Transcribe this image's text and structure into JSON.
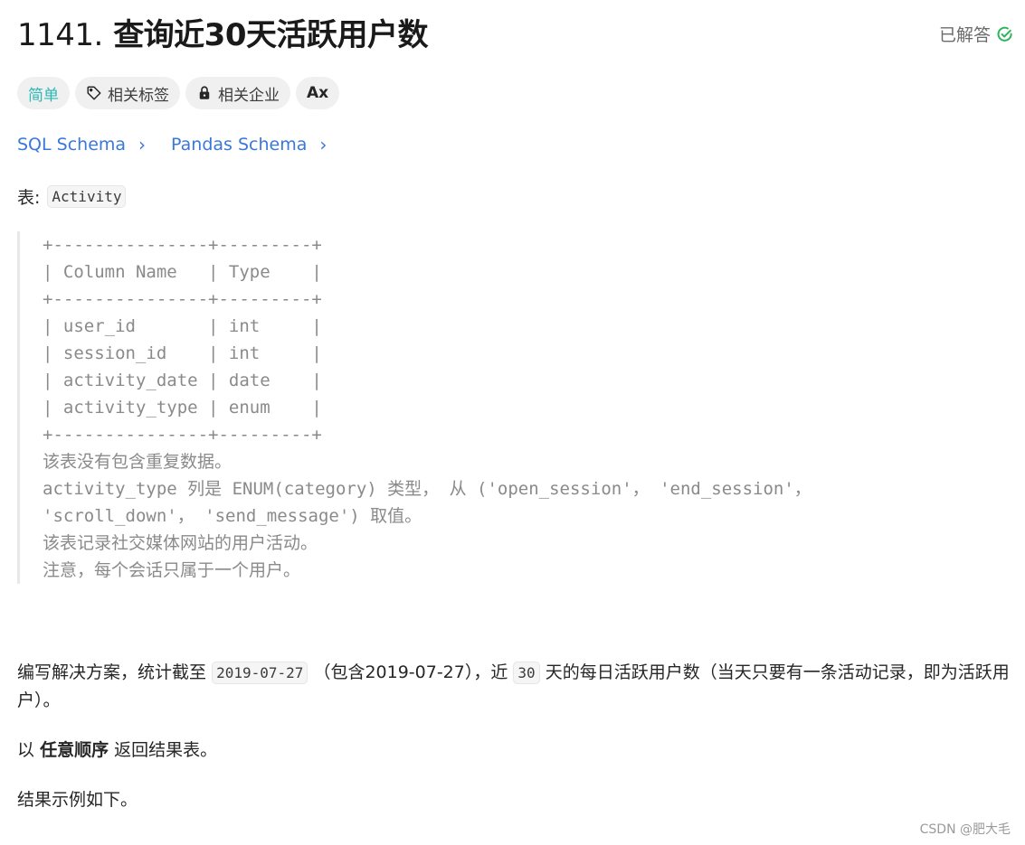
{
  "header": {
    "number": "1141.",
    "title": "查询近30天活跃用户数",
    "status_label": "已解答",
    "status_color": "#2db55d"
  },
  "tags": [
    {
      "label": "简单",
      "icon": null,
      "color": "#2db7b5"
    },
    {
      "label": "相关标签",
      "icon": "tag-icon"
    },
    {
      "label": "相关企业",
      "icon": "lock-icon"
    },
    {
      "label": "Ax",
      "icon": "translate-icon"
    }
  ],
  "schema_links": [
    {
      "label": "SQL Schema"
    },
    {
      "label": "Pandas Schema"
    }
  ],
  "table": {
    "label": "表:",
    "name": "Activity",
    "schema_text": "+---------------+---------+\n| Column Name   | Type    |\n+---------------+---------+\n| user_id       | int     |\n| session_id    | int     |\n| activity_date | date    |\n| activity_type | enum    |\n+---------------+---------+",
    "columns": [
      {
        "name": "user_id",
        "type": "int"
      },
      {
        "name": "session_id",
        "type": "int"
      },
      {
        "name": "activity_date",
        "type": "date"
      },
      {
        "name": "activity_type",
        "type": "enum"
      }
    ],
    "notes": [
      "该表没有包含重复数据。",
      "activity_type 列是 ENUM(category) 类型， 从 ('open_session'， 'end_session'，",
      "'scroll_down'， 'send_message') 取值。",
      "该表记录社交媒体网站的用户活动。",
      "注意，每个会话只属于一个用户。"
    ]
  },
  "description": {
    "p1_a": "编写解决方案，统计截至",
    "p1_code1": "2019-07-27",
    "p1_b": "（包含2019-07-27），近",
    "p1_code2": "30",
    "p1_c": "天的每日活跃用户数（当天只要有一条活动记录，即为活跃用户）。",
    "p2_a": "以",
    "p2_bold": "任意顺序",
    "p2_b": "返回结果表。",
    "p3": "结果示例如下。"
  },
  "watermark": "CSDN @肥大毛"
}
